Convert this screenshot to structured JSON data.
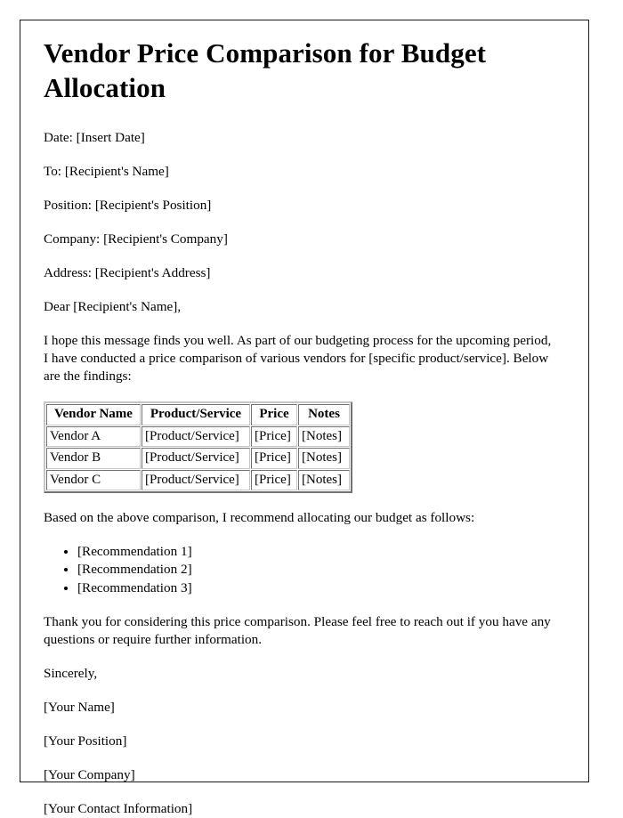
{
  "document": {
    "title": "Vendor Price Comparison for Budget Allocation",
    "header_fields": [
      {
        "label": "Date:",
        "value": "[Insert Date]",
        "text": "Date: [Insert Date]"
      },
      {
        "label": "To:",
        "value": "[Recipient's Name]",
        "text": "To: [Recipient's Name]"
      },
      {
        "label": "Position:",
        "value": "[Recipient's Position]",
        "text": "Position: [Recipient's Position]"
      },
      {
        "label": "Company:",
        "value": "[Recipient's Company]",
        "text": "Company: [Recipient's Company]"
      },
      {
        "label": "Address:",
        "value": "[Recipient's Address]",
        "text": "Address: [Recipient's Address]"
      }
    ],
    "salutation": "Dear [Recipient's Name],",
    "intro_paragraph": "I hope this message finds you well. As part of our budgeting process for the upcoming period, I have conducted a price comparison of various vendors for [specific product/service]. Below are the findings:",
    "table": {
      "headers": [
        "Vendor Name",
        "Product/Service",
        "Price",
        "Notes"
      ],
      "rows": [
        [
          "Vendor A",
          "[Product/Service]",
          "[Price]",
          "[Notes]"
        ],
        [
          "Vendor B",
          "[Product/Service]",
          "[Price]",
          "[Notes]"
        ],
        [
          "Vendor C",
          "[Product/Service]",
          "[Price]",
          "[Notes]"
        ]
      ]
    },
    "recommendation_intro": "Based on the above comparison, I recommend allocating our budget as follows:",
    "recommendations": [
      "[Recommendation 1]",
      "[Recommendation 2]",
      "[Recommendation 3]"
    ],
    "closing_paragraph": "Thank you for considering this price comparison. Please feel free to reach out if you have any questions or require further information.",
    "sign_off": "Sincerely,",
    "signature_block": [
      "[Your Name]",
      "[Your Position]",
      "[Your Company]",
      "[Your Contact Information]"
    ]
  }
}
